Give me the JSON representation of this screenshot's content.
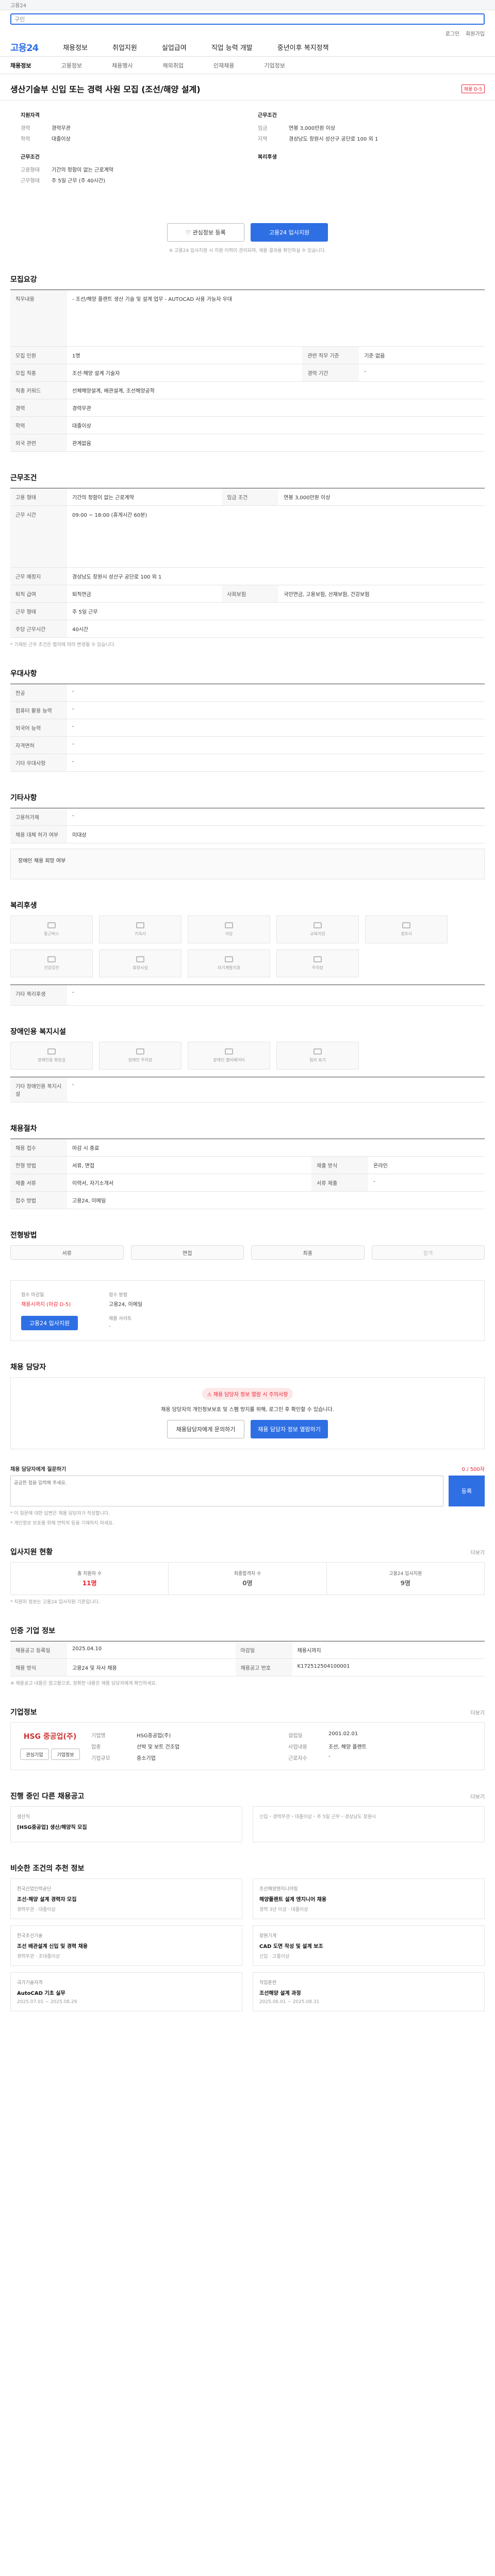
{
  "top": {
    "left": "고용24",
    "right": "로그인 회원가입"
  },
  "search": {
    "placeholder": "구인"
  },
  "utils": [
    "로그인",
    "회원가입"
  ],
  "gnb": {
    "logo": "고용24",
    "items": [
      "채용정보",
      "취업지원",
      "실업급여",
      "직업 능력 개발",
      "중년이후 복지정책"
    ]
  },
  "subnav": [
    "채용정보",
    "고용정보",
    "채용행사",
    "해외취업",
    "인재채용",
    "기업정보"
  ],
  "job": {
    "title": "생산기술부 신입 또는 경력 사원 모집 (조선/해양 설계)",
    "badge": "채용 D-5"
  },
  "summary": {
    "left_title": "지원자격",
    "left": [
      {
        "k": "경력",
        "v": "경력무관"
      },
      {
        "k": "학력",
        "v": "대졸이상"
      }
    ],
    "left2_title": "근무조건",
    "left2": [
      {
        "k": "고용형태",
        "v": "기간의 정함이 없는 근로계약"
      },
      {
        "k": "근무형태",
        "v": "주 5일 근무 (주 40시간)"
      }
    ],
    "right_title": "근무조건",
    "right": [
      {
        "k": "임금",
        "v": "연봉 3,000만원 이상"
      },
      {
        "k": "지역",
        "v": "경상남도 창원시 성산구 공단로 100 외 1"
      }
    ],
    "right2_title": "복리후생"
  },
  "buttons": {
    "scrap": "관심정보 등록",
    "apply": "고용24 입사지원"
  },
  "notice_small": "※ 고용24 입사지원 시 지원 이력이 관리되며, 채용 결과를 확인하실 수 있습니다.",
  "recruit": {
    "title": "모집요강",
    "rows": [
      {
        "k": "직무내용",
        "v": "- 조선/해양 플랜트 생산 기술 및 설계 업무 - AUTOCAD 사용 가능자 우대"
      },
      {
        "k": "모집 인원",
        "v": "1명"
      },
      {
        "k": "모집 직종",
        "v": "조선·해양 설계 기술자"
      },
      {
        "k": "직종 키워드",
        "v": "선체해양설계, 배관설계, 조선해양공학"
      },
      {
        "k": "경력",
        "v": "경력무관"
      },
      {
        "k": "학력",
        "v": "대졸이상"
      },
      {
        "k": "외국 관련",
        "v": "관계없음"
      }
    ],
    "extra": [
      {
        "k": "관련 직무 기준",
        "v": "기준 없음"
      },
      {
        "k": "경력 기간",
        "v": "-"
      }
    ]
  },
  "work": {
    "title": "근무조건",
    "rows": [
      {
        "k": "고용 형태",
        "v": "기간의 정함이 없는 근로계약"
      },
      {
        "k": "임금 조건",
        "v": "연봉 3,000만원 이상"
      },
      {
        "k": "근무 시간",
        "v": "09:00 ~ 18:00 (휴게시간 60분)"
      },
      {
        "k": "근무 예정지",
        "v": "경상남도 창원시 성산구 공단로 100 외 1"
      },
      {
        "k": "퇴직 급여",
        "v": "퇴직연금"
      },
      {
        "k": "사회보험",
        "v": "국민연금, 고용보험, 산재보험, 건강보험"
      },
      {
        "k": "근무 형태",
        "v": "주 5일 근무"
      },
      {
        "k": "주당 근무시간",
        "v": "40시간"
      }
    ],
    "note": "* 기재된 근무 조건은 협의에 따라 변경될 수 있습니다."
  },
  "preference": {
    "title": "우대사항",
    "rows": [
      {
        "k": "전공",
        "v": "-"
      },
      {
        "k": "컴퓨터 활용 능력",
        "v": "-"
      },
      {
        "k": "외국어 능력",
        "v": "-"
      },
      {
        "k": "자격면허",
        "v": "-"
      },
      {
        "k": "기타 우대사항",
        "v": "-"
      }
    ]
  },
  "other": {
    "title": "기타사항",
    "rows": [
      {
        "k": "고용허가제",
        "v": "-"
      },
      {
        "k": "채용 대체 허가 여부",
        "v": "미대상"
      }
    ],
    "note": "장애인 채용 희망 여부"
  },
  "welfare": {
    "title": "복리후생",
    "tiles": [
      "통근버스",
      "기숙사",
      "식당",
      "교육지원",
      "경조사",
      "건강검진",
      "휴양시설",
      "자기계발지원",
      "주차장"
    ],
    "etc_k": "기타 복리후생",
    "etc_v": "-"
  },
  "disabled": {
    "title": "장애인용 복지시설",
    "tiles": [
      "장애인용 화장실",
      "장애인 주차장",
      "장애인 엘리베이터",
      "점자 표기"
    ],
    "etc_k": "기타 장애인용 복지시설",
    "etc_v": "-"
  },
  "process": {
    "title": "채용절차",
    "rows": [
      {
        "k": "채용 접수",
        "v": "마감 시 종료"
      },
      {
        "k": "전형 방법",
        "v": "서류, 면접"
      },
      {
        "k": "제출 서류",
        "v": "이력서, 자기소개서"
      },
      {
        "k": "접수 방법",
        "v": "고용24, 이메일"
      }
    ],
    "side": [
      {
        "k": "제출 방식",
        "v": "온라인"
      },
      {
        "k": "서류 제출",
        "v": "-"
      }
    ]
  },
  "apply_method": {
    "title": "전형방법",
    "steps": [
      "서류",
      "면접",
      "최종",
      "합격"
    ]
  },
  "contact": {
    "title_k": "접수 마감일",
    "deadline": "채용시까지 (마감 D-5)",
    "apply_btn": "고용24 입사지원",
    "page_k": "접수 방법",
    "page_v": "고용24, 이메일",
    "home_k": "채용 사이트",
    "home_v": "-"
  },
  "manager": {
    "title": "채용 담당자",
    "alert": "채용 담당자 정보 열람 시 주의사항",
    "msg": "채용 담당자의 개인정보보호 및 스팸 방지를 위해, 로그인 후 확인할 수 있습니다.",
    "btn1": "채용담당자에게 문의하기",
    "btn2": "채용 담당자 정보 열람하기"
  },
  "qa": {
    "title": "채용 담당자에게 질문하기",
    "count": "0 / 500자",
    "placeholder": "궁금한 점을 입력해 주세요.",
    "go": "등록",
    "notes": [
      "* 이 질문에 대한 답변은 채용 담당자가 작성합니다.",
      "* 개인정보 보호를 위해 연락처 등을 기재하지 마세요."
    ]
  },
  "stats": {
    "title": "입사지원 현황",
    "more": "더보기",
    "cells": [
      {
        "k": "총 지원자 수",
        "v": "11명"
      },
      {
        "k": "최종합격자 수",
        "v": "0명"
      },
      {
        "k": "고용24 입사지원",
        "v": "9명"
      }
    ],
    "note": "* 지원자 정보는 고용24 입사지원 기준입니다."
  },
  "info": {
    "title": "인증 기업 정보",
    "rows": [
      {
        "k": "채용공고 등록일",
        "v": "2025.04.10",
        "k2": "마감일",
        "v2": "채용시까지"
      },
      {
        "k": "채용 방식",
        "v": "고용24 및 자사 채용",
        "k2": "채용공고 번호",
        "v2": "K172512504100001"
      }
    ],
    "note": "※ 채용공고 내용은 참고용으로, 정확한 내용은 채용 담당자에게 확인하세요."
  },
  "company": {
    "title": "기업정보",
    "more": "더보기",
    "logo": "HSG 중공업(주)",
    "btn1": "관심기업",
    "btn2": "기업정보",
    "rows": [
      {
        "k": "기업명",
        "v": "HSG중공업(주)",
        "k2": "설립일",
        "v2": "2001.02.01"
      },
      {
        "k": "업종",
        "v": "선박 및 보트 건조업",
        "k2": "사업내용",
        "v2": "조선, 해양 플랜트"
      },
      {
        "k": "기업규모",
        "v": "중소기업",
        "k2": "근로자수",
        "v2": "-"
      }
    ]
  },
  "similar": {
    "title": "진행 중인 다른 채용공고",
    "more": "더보기",
    "left_title": "생산직",
    "left_sub": "[HSG중공업] 생산/해양직 모집",
    "right": [
      "신입",
      "경력무관",
      "대졸이상",
      "주 5일 근무",
      "경상남도 창원시"
    ]
  },
  "recommend": {
    "title": "비슷한 조건의 추천 정보",
    "cards": [
      {
        "n": "한국산업인력공단",
        "t": "조선·해양 설계 경력자 모집",
        "m": "경력무관 · 대졸이상"
      },
      {
        "n": "조선해양엔지니어링",
        "t": "해양플랜트 설계 엔지니어 채용",
        "m": "경력 3년 이상 · 대졸이상"
      },
      {
        "n": "한국조선기술",
        "t": "조선 배관설계 신입 및 경력 채용",
        "m": "경력무관 · 초대졸이상"
      },
      {
        "n": "창원기계",
        "t": "CAD 도면 작성 및 설계 보조",
        "m": "신입 · 고졸이상"
      },
      {
        "n": "국가기술자격",
        "t": "AutoCAD 기초 실무",
        "m": "2025.07.01 ~ 2025.08.29"
      },
      {
        "n": "직업훈련",
        "t": "조선해양 설계 과정",
        "m": "2025.06.01 ~ 2025.08.31"
      }
    ]
  }
}
